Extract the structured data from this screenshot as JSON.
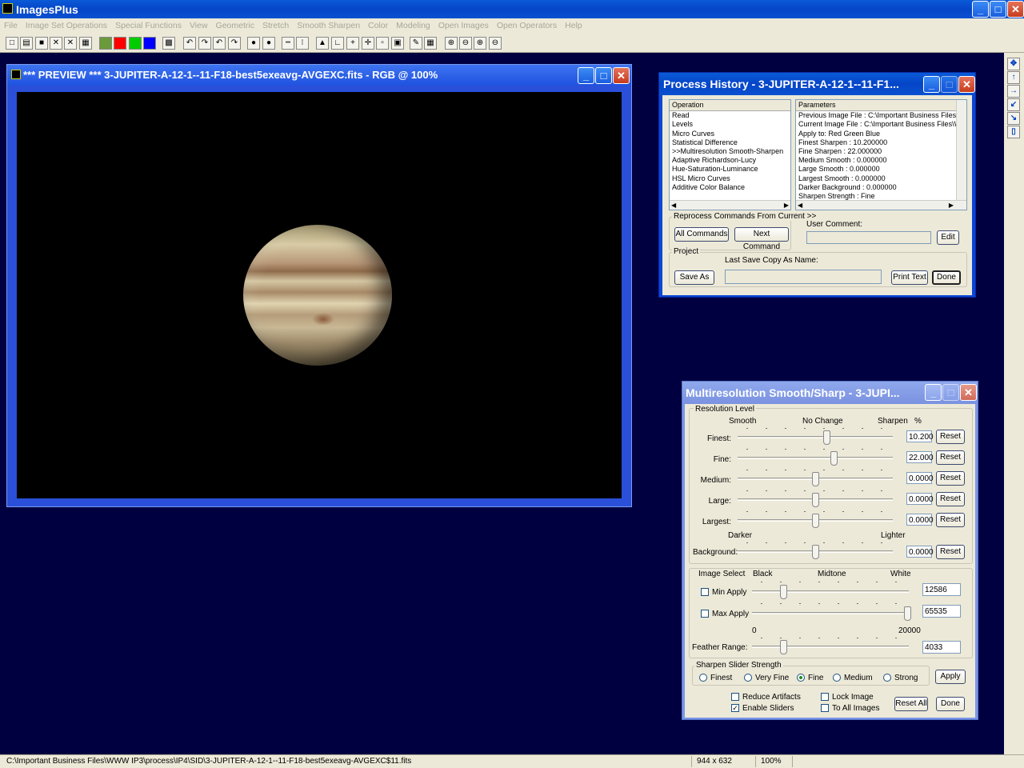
{
  "app": {
    "title": "ImagesPlus",
    "menu": [
      "File",
      "Image Set Operations",
      "Special Functions",
      "View",
      "Geometric",
      "Stretch",
      "Smooth Sharpen",
      "Color",
      "Modeling",
      "Open Images",
      "Open Operators",
      "Help"
    ],
    "window_buttons": {
      "minimize": "_",
      "maximize": "□",
      "close": "✕"
    }
  },
  "toolbar": {
    "icons": [
      "new-icon",
      "open-icon",
      "save-icon",
      "close-icon",
      "close-all-icon",
      "print-icon",
      "rgb-icon",
      "red-channel-icon",
      "green-channel-icon",
      "blue-channel-icon",
      "grayscale-icon",
      "undo-icon",
      "redo-icon",
      "undo-all-icon",
      "redo-all-icon",
      "mark-icon",
      "unmark-icon",
      "line-select-icon",
      "point-select-icon",
      "histogram-icon",
      "levels-icon",
      "add-icon",
      "crosshair-icon",
      "grid-icon",
      "image-icon",
      "pencil-icon",
      "table-icon",
      "zoom-in-icon",
      "zoom-out-icon",
      "zoom-fit-icon",
      "zoom-actual-icon"
    ],
    "glyphs": [
      "□",
      "▤",
      "■",
      "✕",
      "✕",
      "▦",
      "",
      "",
      "",
      "",
      "▩",
      "↶",
      "↷",
      "↶",
      "↷",
      "●",
      "●",
      "┅",
      "⁝",
      "▲",
      "∟",
      "+",
      "✛",
      "▫",
      "▣",
      "✎",
      "▦",
      "⊕",
      "⊖",
      "⊕",
      "⊖"
    ],
    "colors": {
      "rgb-icon": "#6a9a3a",
      "red-channel-icon": "#ff0000",
      "green-channel-icon": "#00cc00",
      "blue-channel-icon": "#0000ff"
    }
  },
  "right_toolbar": {
    "glyphs": [
      "✥",
      "↑",
      "→",
      "↙",
      "↘",
      "▯"
    ]
  },
  "preview": {
    "title": "*** PREVIEW *** 3-JUPITER-A-12-1--11-F18-best5exeavg-AVGEXC.fits - RGB @  100%"
  },
  "history": {
    "title": "Process History - 3-JUPITER-A-12-1--11-F1...",
    "operation_header": "Operation",
    "operations": [
      "Read",
      "Levels",
      "Micro Curves",
      "Statistical Difference",
      ">>Multiresolution Smooth-Sharpen",
      "Adaptive Richardson-Lucy",
      "Hue-Saturation-Luminance",
      "HSL Micro Curves",
      "Additive Color Balance"
    ],
    "parameters_header": "Parameters",
    "parameters": [
      "Previous Image File : C:\\Important Business Files\\W",
      "Current Image File : C:\\Important Business Files\\W\\",
      "Apply to:  Red Green Blue",
      "Finest Sharpen : 10.200000",
      "Fine Sharpen : 22.000000",
      "Medium Smooth : 0.000000",
      "Large Smooth : 0.000000",
      "Largest Smooth : 0.000000",
      "Darker Background : 0.000000",
      "Sharpen Strength : Fine"
    ],
    "reprocess_label": "Reprocess Commands From Current >>",
    "all_commands": "All Commands",
    "next_command": "Next Command",
    "user_comment_label": "User Comment:",
    "edit": "Edit",
    "project_label": "Project",
    "last_save_label": "Last Save Copy As Name:",
    "save_as": "Save As",
    "print_text": "Print Text",
    "done": "Done"
  },
  "msharp": {
    "title": "Multiresolution Smooth/Sharp - 3-JUPI...",
    "resolution_level": "Resolution Level",
    "smooth": "Smooth",
    "no_change": "No Change",
    "sharpen": "Sharpen",
    "percent": "%",
    "sliders": [
      {
        "label": "Finest:",
        "value": "10.200",
        "level": 0.57
      },
      {
        "label": "Fine:",
        "value": "22.000",
        "level": 0.62
      },
      {
        "label": "Medium:",
        "value": "0.0000",
        "level": 0.5
      },
      {
        "label": "Large:",
        "value": "0.0000",
        "level": 0.5
      },
      {
        "label": "Largest:",
        "value": "0.0000",
        "level": 0.5
      }
    ],
    "darker": "Darker",
    "lighter": "Lighter",
    "background": {
      "label": "Background:",
      "value": "0.0000",
      "level": 0.5
    },
    "reset": "Reset",
    "image_select": "Image Select",
    "black": "Black",
    "midtone": "Midtone",
    "white": "White",
    "min_apply": {
      "label": "Min Apply",
      "value": "12586",
      "checked": false,
      "level": 0.2
    },
    "max_apply": {
      "label": "Max Apply",
      "value": "65535",
      "checked": false,
      "level": 1.0
    },
    "range_min": "0",
    "range_max": "20000",
    "feather": {
      "label": "Feather Range:",
      "value": "4033",
      "level": 0.2
    },
    "strength_label": "Sharpen Slider Strength",
    "strengths": [
      "Finest",
      "Very Fine",
      "Fine",
      "Medium",
      "Strong"
    ],
    "strength_selected": "Fine",
    "apply": "Apply",
    "reduce_artifacts": "Reduce Artifacts",
    "enable_sliders": "Enable Sliders",
    "lock_image": "Lock Image",
    "to_all_images": "To All Images",
    "reduce_checked": false,
    "enable_checked": true,
    "reset_all": "Reset All",
    "done": "Done"
  },
  "status": {
    "path": "C:\\Important Business Files\\WWW IP3\\process\\IP4\\SID\\3-JUPITER-A-12-1--11-F18-best5exeavg-AVGEXC$11.fits",
    "size": "944 x 632",
    "zoom": "100%"
  }
}
